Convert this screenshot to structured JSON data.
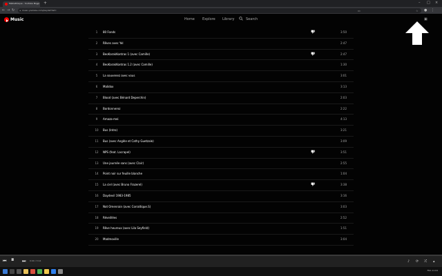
{
  "browser": {
    "tab_title": "Médiathèque - YouTube Music",
    "tab_close": "×",
    "new_tab": "+",
    "url": "music.youtube.com/playlist?list=",
    "window_controls": [
      "–",
      "□",
      "×"
    ]
  },
  "app": {
    "logo_text": "Music",
    "nav": {
      "home": "Home",
      "explore": "Explore",
      "library": "Library",
      "search": "Search"
    }
  },
  "tracks": [
    {
      "index": "1",
      "title": "80 Fonds",
      "duration": "3:50",
      "disliked": true
    },
    {
      "index": "2",
      "title": "Rêves avec Yel",
      "duration": "2:47",
      "disliked": false
    },
    {
      "index": "3",
      "title": "BeoKarakKontras 1 (avec Camille)",
      "duration": "2:47",
      "disliked": true
    },
    {
      "index": "4",
      "title": "BeoKarakKontras 1.2 (avec Camille)",
      "duration": "1:30",
      "disliked": false
    },
    {
      "index": "5",
      "title": "La souvenez avec vous",
      "duration": "3:01",
      "disliked": false
    },
    {
      "index": "6",
      "title": "Malidox",
      "duration": "3:13",
      "disliked": false
    },
    {
      "index": "7",
      "title": "Blood (avec Bénard Deperchin)",
      "duration": "2:03",
      "disliked": false
    },
    {
      "index": "8",
      "title": "Bordonnerez",
      "duration": "2:22",
      "disliked": false
    },
    {
      "index": "9",
      "title": "Amaza-mei",
      "duration": "4:13",
      "disliked": false
    },
    {
      "index": "10",
      "title": "Bus (Intro)",
      "duration": "3:21",
      "disliked": false
    },
    {
      "index": "11",
      "title": "Bus (avec Angèle et Cathy Guetzale)",
      "duration": "3:09",
      "disliked": false
    },
    {
      "index": "12",
      "title": "NPS (feat. Lacrapel)",
      "duration": "3:51",
      "disliked": true
    },
    {
      "index": "13",
      "title": "Une journée sans (avec Clair)",
      "duration": "2:55",
      "disliked": false
    },
    {
      "index": "14",
      "title": "Point noir sur feuille blanche",
      "duration": "1:04",
      "disliked": false
    },
    {
      "index": "15",
      "title": "La ciel (avec Bruno Frazerel)",
      "duration": "3:38",
      "disliked": true
    },
    {
      "index": "16",
      "title": "Daydevil 1983-1985",
      "duration": "3:16",
      "disliked": false
    },
    {
      "index": "17",
      "title": "Not Omenrain (avec Corraltique.S)",
      "duration": "3:03",
      "disliked": false
    },
    {
      "index": "18",
      "title": "Réveillées",
      "duration": "2:52",
      "disliked": false
    },
    {
      "index": "19",
      "title": "Rêve heureux (avec Lila Seyfield)",
      "duration": "1:51",
      "disliked": false
    },
    {
      "index": "20",
      "title": "Madmoville",
      "duration": "3:04",
      "disliked": false
    }
  ],
  "player": {
    "time": "0:00 / 3:14",
    "progress_fraction": 0.0
  },
  "taskbar": {
    "tray_text": "FRA 11:04"
  },
  "colors": {
    "accent": "#ff0000",
    "background": "#030303",
    "player_bg": "#212121"
  }
}
